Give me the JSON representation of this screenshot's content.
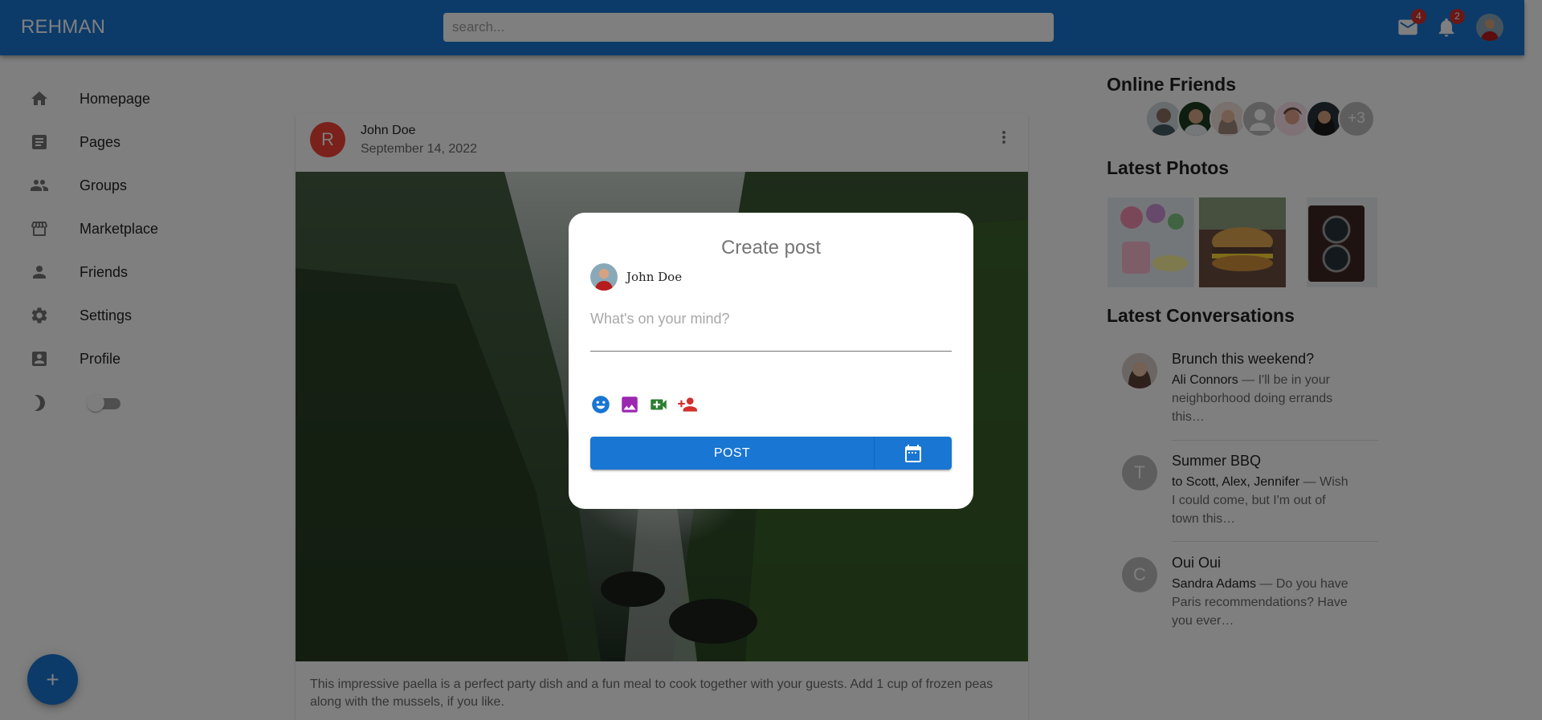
{
  "appbar": {
    "logo": "REHMAN",
    "search_placeholder": "search...",
    "mail_badge": "4",
    "notif_badge": "2",
    "color": "#1976d2"
  },
  "sidebar": {
    "items": [
      {
        "label": "Homepage",
        "icon": "home-icon"
      },
      {
        "label": "Pages",
        "icon": "article-icon"
      },
      {
        "label": "Groups",
        "icon": "group-icon"
      },
      {
        "label": "Marketplace",
        "icon": "storefront-icon"
      },
      {
        "label": "Friends",
        "icon": "person-icon"
      },
      {
        "label": "Settings",
        "icon": "gear-icon"
      },
      {
        "label": "Profile",
        "icon": "account-box-icon"
      }
    ],
    "dark_mode_enabled": false,
    "fab_label": "+"
  },
  "post": {
    "avatar_letter": "R",
    "author": "John Doe",
    "date": "September 14, 2022",
    "text": "This impressive paella is a perfect party dish and a fun meal to cook together with your guests. Add 1 cup of frozen peas along with the mussels, if you like."
  },
  "right": {
    "online_title": "Online Friends",
    "online_more": "+3",
    "photos_title": "Latest Photos",
    "conversations_title": "Latest Conversations",
    "conversations": [
      {
        "title": "Brunch this weekend?",
        "from": "Ali Connors",
        "snippet": " — I'll be in your neighborhood doing errands this…",
        "avatar": ""
      },
      {
        "title": "Summer BBQ",
        "from": "to Scott, Alex, Jennifer",
        "snippet": " — Wish I could come, but I'm out of town this…",
        "avatar": "T"
      },
      {
        "title": "Oui Oui",
        "from": "Sandra Adams",
        "snippet": " — Do you have Paris recommendations? Have you ever…",
        "avatar": "C"
      }
    ]
  },
  "modal": {
    "title": "Create post",
    "user": "John Doe",
    "placeholder": "What's on your mind?",
    "post_label": "POST",
    "tool_icons": [
      "emoji-icon",
      "image-icon",
      "video-icon",
      "tag-person-icon"
    ],
    "tool_colors": [
      "#1976d2",
      "#9c27b0",
      "#2e7d32",
      "#d32f2f"
    ]
  }
}
